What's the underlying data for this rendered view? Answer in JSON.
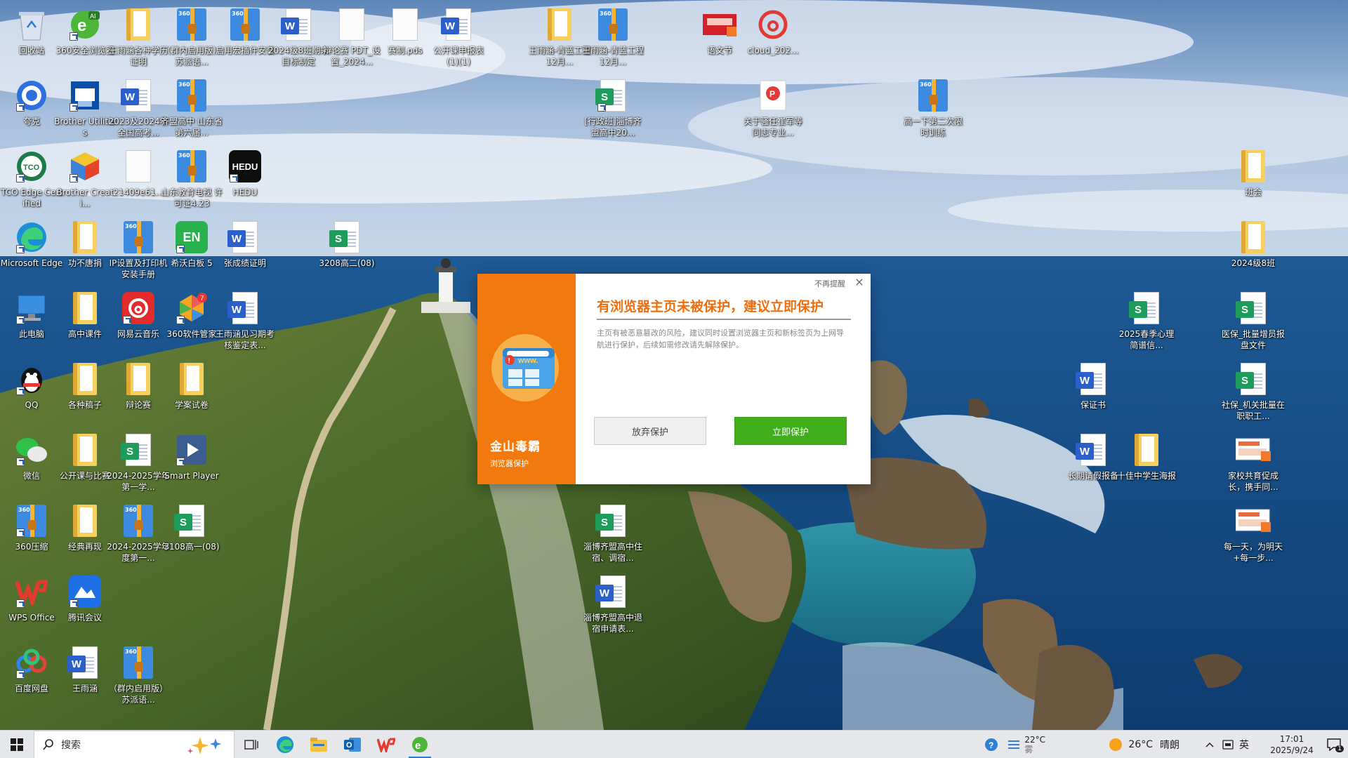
{
  "desktop": {
    "icons": [
      {
        "id": "recycle",
        "label": "回收站",
        "type": "recycle"
      },
      {
        "id": "browser360",
        "label": "360安全浏览器",
        "type": "browser360"
      },
      {
        "id": "wangyuhan1",
        "label": "王雨涵各种学历证明",
        "type": "folder-v"
      },
      {
        "id": "qunnei1",
        "label": "（群内启用版）苏派语...",
        "type": "zip"
      },
      {
        "id": "qiyong",
        "label": "启用宏插件安装",
        "type": "zip"
      },
      {
        "id": "q2024b",
        "label": "2024级8班期末目标制定",
        "type": "word"
      },
      {
        "id": "bianlun_pdf",
        "label": "辩论赛 PDT_设置_2024...",
        "type": "blank"
      },
      {
        "id": "saizhi",
        "label": "赛制.pds",
        "type": "blank"
      },
      {
        "id": "gongkai",
        "label": "公开课申报表 (1)(1)",
        "type": "word"
      },
      {
        "id": "wangyh_qinglan1",
        "label": "王雨涵-青蓝工程12月...",
        "type": "folder-v"
      },
      {
        "id": "wangyh_qinglan2",
        "label": "王雨涵-青蓝工程12月...",
        "type": "zip"
      },
      {
        "id": "yuwenshi",
        "label": "语文节",
        "type": "redcard"
      },
      {
        "id": "cloud",
        "label": "cloud_202...",
        "type": "netease"
      },
      {
        "id": "sihao",
        "label": "夸克",
        "type": "quark"
      },
      {
        "id": "brother_util",
        "label": "Brother Utilities",
        "type": "brother"
      },
      {
        "id": "gaokao2023",
        "label": "2023及2024年全国高考...",
        "type": "word"
      },
      {
        "id": "qimeng",
        "label": "齐盟高中 山东省第六届...",
        "type": "zip"
      },
      {
        "id": "xingzheng",
        "label": "[行政班]淄博齐盟高中20...",
        "type": "excel"
      },
      {
        "id": "guanyu",
        "label": "关于骚任崔军等同志专业...",
        "type": "pdfred"
      },
      {
        "id": "gaoyi",
        "label": "高一下第二次限时训练",
        "type": "zip"
      },
      {
        "id": "tco",
        "label": "TCO Edge Certified",
        "type": "tco"
      },
      {
        "id": "brother_create",
        "label": "Brother Creati...",
        "type": "brothercube"
      },
      {
        "id": "file21409",
        "label": "21409e61...",
        "type": "blank"
      },
      {
        "id": "shandong",
        "label": "山东教育电视 许可证4.23",
        "type": "zip"
      },
      {
        "id": "hedu",
        "label": "HEDU",
        "type": "hedu"
      },
      {
        "id": "banhui",
        "label": "班会",
        "type": "folder-v"
      },
      {
        "id": "edge",
        "label": "Microsoft Edge",
        "type": "edge"
      },
      {
        "id": "gongbu",
        "label": "功不唐捐",
        "type": "folder-v"
      },
      {
        "id": "ipshezhi",
        "label": "IP设置及打印机安装手册",
        "type": "zip"
      },
      {
        "id": "xiwo",
        "label": "希沃白板 5",
        "type": "seewo"
      },
      {
        "id": "zhangcj",
        "label": "张成绩证明",
        "type": "word"
      },
      {
        "id": "gaoer3208",
        "label": "3208高二(08)",
        "type": "excel"
      },
      {
        "id": "ji2024_8",
        "label": "2024级8班",
        "type": "folder-v"
      },
      {
        "id": "thispc",
        "label": "此电脑",
        "type": "pc"
      },
      {
        "id": "gaozhongke",
        "label": "高中课件",
        "type": "folder-v"
      },
      {
        "id": "neteasemusic",
        "label": "网易云音乐",
        "type": "neteasemusic"
      },
      {
        "id": "guanjia360",
        "label": "360软件管家",
        "type": "guanjia"
      },
      {
        "id": "wangyuhan_jx",
        "label": "王雨涵见习期考核鉴定表...",
        "type": "word"
      },
      {
        "id": "chunji2025",
        "label": "2025春季心理简谱信...",
        "type": "excel"
      },
      {
        "id": "yibao",
        "label": "医保_批量增员报盘文件",
        "type": "excel"
      },
      {
        "id": "qq",
        "label": "QQ",
        "type": "qq"
      },
      {
        "id": "gezhong",
        "label": "各种稿子",
        "type": "folder-v"
      },
      {
        "id": "bianlunsai",
        "label": "辩论赛",
        "type": "folder-v"
      },
      {
        "id": "xuean",
        "label": "学案试卷",
        "type": "folder-v"
      },
      {
        "id": "baozhengshu",
        "label": "保证书",
        "type": "word"
      },
      {
        "id": "shebao",
        "label": "社保_机关批量在职职工...",
        "type": "excel"
      },
      {
        "id": "wechat",
        "label": "微信",
        "type": "wechat"
      },
      {
        "id": "gongkaike",
        "label": "公开课与比赛",
        "type": "folder-v"
      },
      {
        "id": "xuenian2024",
        "label": "2024-2025学年第一学...",
        "type": "excel"
      },
      {
        "id": "smartplayer",
        "label": "Smart Player",
        "type": "smartplayer"
      },
      {
        "id": "changqi",
        "label": "长期请假报备",
        "type": "word"
      },
      {
        "id": "shijia",
        "label": "十佳中学生海报",
        "type": "folder-v"
      },
      {
        "id": "jiaxiao",
        "label": "家校共育促成长，携手同...",
        "type": "pptthumb"
      },
      {
        "id": "zip360",
        "label": "360压缩",
        "type": "zip"
      },
      {
        "id": "jingdian",
        "label": "经典再现",
        "type": "folder-v"
      },
      {
        "id": "xuenian2024b",
        "label": "2024-2025学年度第一...",
        "type": "zip"
      },
      {
        "id": "gaoyi3108",
        "label": "3108高一(08)",
        "type": "excel"
      },
      {
        "id": "zibo_zhusu",
        "label": "淄博齐盟高中住宿、调宿...",
        "type": "excel"
      },
      {
        "id": "meiyitian",
        "label": "每一天，为明天+每一步...",
        "type": "pptthumb"
      },
      {
        "id": "wps",
        "label": "WPS Office",
        "type": "wps"
      },
      {
        "id": "tencentmeet",
        "label": "腾讯会议",
        "type": "tmeet"
      },
      {
        "id": "zibo_tuisu",
        "label": "淄博齐盟高中退宿申请表...",
        "type": "word"
      },
      {
        "id": "baidupan",
        "label": "百度网盘",
        "type": "baidupan"
      },
      {
        "id": "wangyuhan_doc",
        "label": "王雨涵",
        "type": "word"
      },
      {
        "id": "qunnei2",
        "label": "（群内启用版）苏派语...",
        "type": "zip"
      }
    ]
  },
  "dialog": {
    "no_remind": "不再提醒",
    "close": "×",
    "title": "有浏览器主页未被保护，建议立即保护",
    "description": "主页有被恶意篡改的风险，建议同时设置浏览器主页和新标签页为上网导航进行保护，后续如需修改请先解除保护。",
    "brand": "金山毒霸",
    "brand_sub": "浏览器保护",
    "btn_give_up": "放弃保护",
    "btn_protect": "立即保护",
    "accent": "#f2790d",
    "green": "#3fad1c"
  },
  "taskbar": {
    "search_placeholder": "搜索",
    "weather_small_temp": "22°C",
    "weather_small_cond": "雾",
    "weather_temp": "26°C",
    "weather_cond": "晴朗",
    "ime": "英",
    "time": "17:01",
    "date": "2025/9/24",
    "notification_count": "1",
    "apps": [
      "task-view-icon",
      "edge-icon",
      "file-explorer-icon",
      "outlook-icon",
      "wps-icon",
      "browser360-icon"
    ]
  }
}
